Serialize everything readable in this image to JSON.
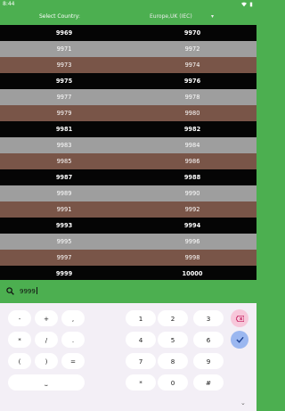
{
  "status": {
    "time": "8:44"
  },
  "header": {
    "country_label": "Select Country:",
    "country_value": "Europe,UK (IEC)",
    "chevron": "▾"
  },
  "rows": [
    [
      "9969",
      "9970"
    ],
    [
      "9971",
      "9972"
    ],
    [
      "9973",
      "9974"
    ],
    [
      "9975",
      "9976"
    ],
    [
      "9977",
      "9978"
    ],
    [
      "9979",
      "9980"
    ],
    [
      "9981",
      "9982"
    ],
    [
      "9983",
      "9984"
    ],
    [
      "9985",
      "9986"
    ],
    [
      "9987",
      "9988"
    ],
    [
      "9989",
      "9990"
    ],
    [
      "9991",
      "9992"
    ],
    [
      "9993",
      "9994"
    ],
    [
      "9995",
      "9996"
    ],
    [
      "9997",
      "9998"
    ],
    [
      "9999",
      "10000"
    ]
  ],
  "row_colors": [
    "black",
    "grey",
    "brown",
    "black",
    "grey",
    "brown",
    "black",
    "grey",
    "brown",
    "black",
    "grey",
    "brown",
    "black",
    "grey",
    "brown",
    "black"
  ],
  "search": {
    "value": "9999"
  },
  "keyboard": {
    "left_keys": [
      [
        "-",
        "+",
        ","
      ],
      [
        "*",
        "/",
        "."
      ],
      [
        "(",
        ")",
        "="
      ]
    ],
    "num_keys": [
      [
        "1",
        "2",
        "3"
      ],
      [
        "4",
        "5",
        "6"
      ],
      [
        "7",
        "8",
        "9"
      ],
      [
        "*",
        "0",
        "#"
      ]
    ],
    "space_label": "⎵"
  }
}
